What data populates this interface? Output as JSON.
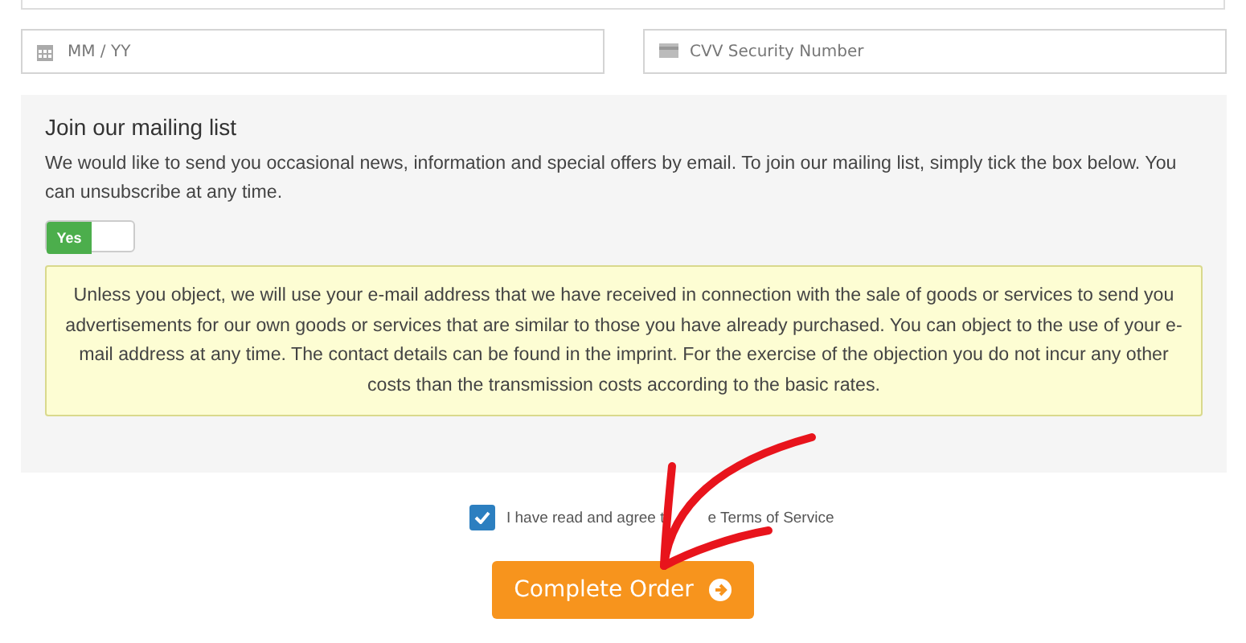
{
  "card_fields": [
    {
      "placeholder": "MM / YY"
    },
    {
      "placeholder": "CVV Security Number"
    }
  ],
  "mailing_list": {
    "title": "Join our mailing list",
    "description": "We would like to send you occasional news, information and special offers by email. To join our mailing list, simply tick the box below. You can unsubscribe at any time.",
    "toggle": {
      "label": "Yes",
      "on": true
    },
    "notice": "Unless you object, we will use your e-mail address that we have received in connection with the sale of goods or services to send you advertisements for our own goods or services that are similar to those you have already purchased. You can object to the use of your e-mail address at any time. The contact details can be found in the imprint. For the exercise of the objection you do not incur any other costs than the transmission costs according to the basic rates."
  },
  "terms": {
    "label_parts": [
      "I have read and agree t",
      "e Terms of Service"
    ],
    "checked": true
  },
  "submit_button": {
    "label": "Complete Order"
  }
}
